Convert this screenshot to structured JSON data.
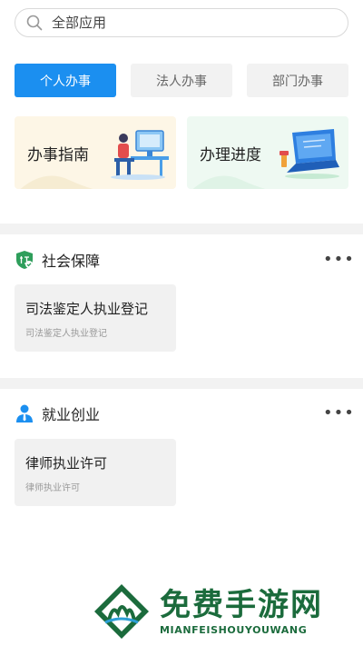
{
  "search": {
    "placeholder": "全部应用"
  },
  "tabs": [
    {
      "label": "个人办事",
      "active": true
    },
    {
      "label": "法人办事",
      "active": false
    },
    {
      "label": "部门办事",
      "active": false
    }
  ],
  "cards": [
    {
      "label": "办事指南"
    },
    {
      "label": "办理进度"
    }
  ],
  "sections": [
    {
      "title": "社会保障",
      "icon": "shield-icon",
      "more": "•••",
      "items": [
        {
          "title": "司法鉴定人执业登记",
          "subtitle": "司法鉴定人执业登记"
        }
      ]
    },
    {
      "title": "就业创业",
      "icon": "person-icon",
      "more": "•••",
      "items": [
        {
          "title": "律师执业许可",
          "subtitle": "律师执业许可"
        }
      ]
    }
  ],
  "watermark": {
    "cn": "免费手游网",
    "en": "MIANFEISHOUYOUWANG"
  },
  "colors": {
    "accent": "#1b8ff0",
    "guide_bg": "#fdf6e6",
    "progress_bg": "#eef9f2",
    "watermark": "#1b6b3c"
  }
}
